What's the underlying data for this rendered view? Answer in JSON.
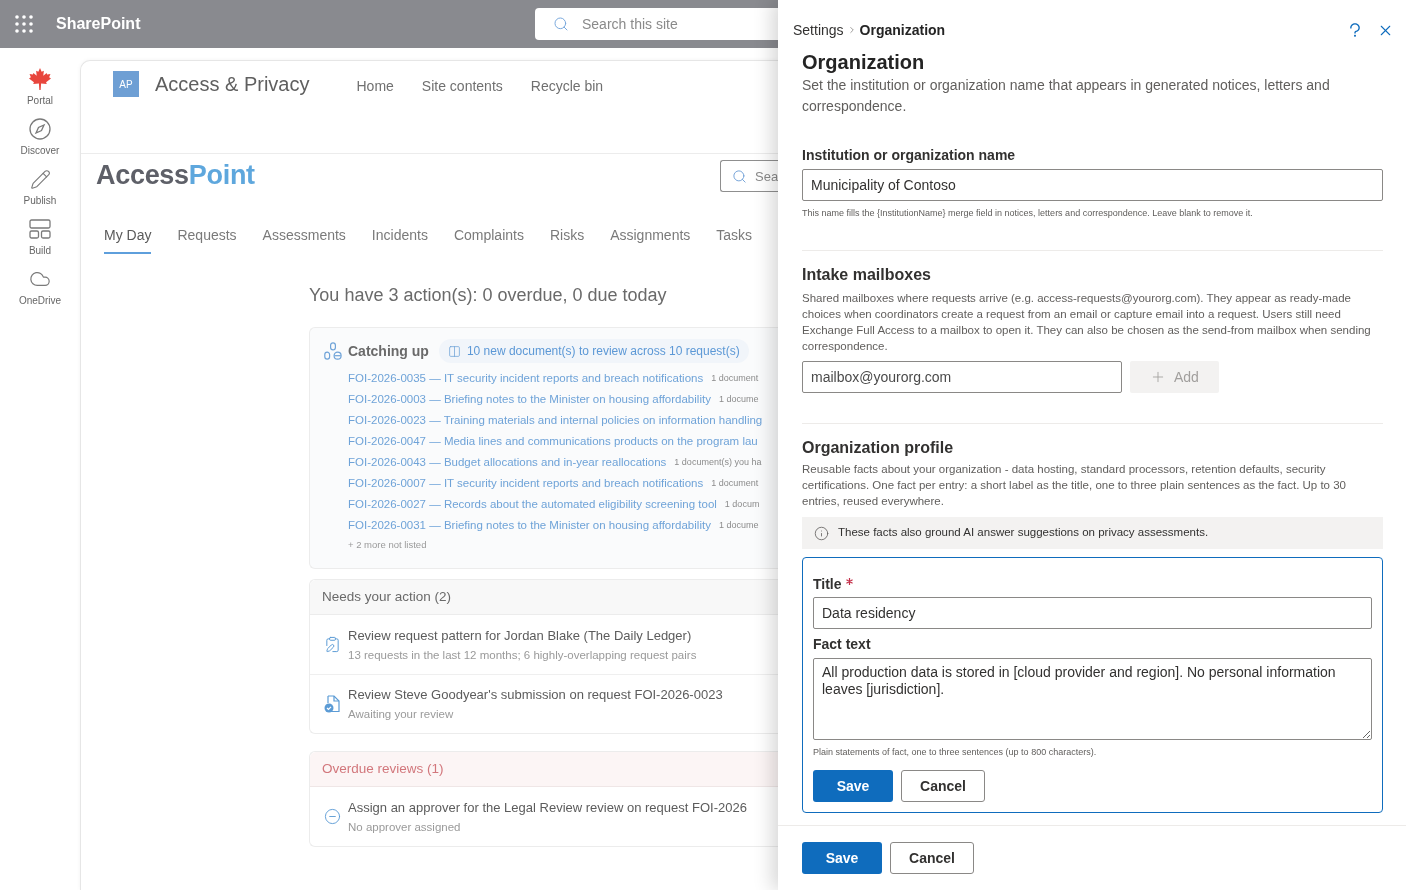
{
  "suite_bar": {
    "app_name": "SharePoint",
    "search": {
      "placeholder": "Search this site"
    }
  },
  "app_bar": {
    "items": [
      {
        "label": "Portal"
      },
      {
        "label": "Discover"
      },
      {
        "label": "Publish"
      },
      {
        "label": "Build"
      },
      {
        "label": "OneDrive"
      }
    ]
  },
  "site": {
    "logo_initials": "AP",
    "title": "Access & Privacy",
    "nav": [
      {
        "label": "Home"
      },
      {
        "label": "Site contents"
      },
      {
        "label": "Recycle bin"
      }
    ]
  },
  "app": {
    "logo": {
      "part_1": "Access",
      "part_2": "Point"
    },
    "search": {
      "placeholder": "Sea"
    },
    "tabs": [
      {
        "label": "My Day",
        "selected": true
      },
      {
        "label": "Requests",
        "selected": false
      },
      {
        "label": "Assessments",
        "selected": false
      },
      {
        "label": "Incidents",
        "selected": false
      },
      {
        "label": "Complaints",
        "selected": false
      },
      {
        "label": "Risks",
        "selected": false
      },
      {
        "label": "Assignments",
        "selected": false
      },
      {
        "label": "Tasks",
        "selected": false
      }
    ]
  },
  "summary": "You have 3 action(s): 0 overdue, 0 due today",
  "catching_up": {
    "title": "Catching up",
    "badge": "10 new document(s) to review across 10 request(s)",
    "items": [
      {
        "link": "FOI-2026-0035 — IT security incident reports and breach notifications",
        "note": "1 document"
      },
      {
        "link": "FOI-2026-0003 — Briefing notes to the Minister on housing affordability",
        "note": "1 docume"
      },
      {
        "link": "FOI-2026-0023 — Training materials and internal policies on information handling"
      },
      {
        "link": "FOI-2026-0047 — Media lines and communications products on the program lau"
      },
      {
        "link": "FOI-2026-0043 — Budget allocations and in-year reallocations",
        "note": "1 document(s) you ha"
      },
      {
        "link": "FOI-2026-0007 — IT security incident reports and breach notifications",
        "note": "1 document"
      },
      {
        "link": "FOI-2026-0027 — Records about the automated eligibility screening tool",
        "note": "1 docum"
      },
      {
        "link": "FOI-2026-0031 — Briefing notes to the Minister on housing affordability",
        "note": "1 docume"
      }
    ],
    "more": "+ 2 more not listed"
  },
  "action_groups": [
    {
      "kind": "normal",
      "title": "Needs your action (2)",
      "items": [
        {
          "kind": "pattern",
          "title": "Review request pattern for Jordan Blake (The Daily Ledger)",
          "subtitle": "13 requests in the last 12 months; 6 highly-overlapping request pairs"
        },
        {
          "kind": "submission",
          "title": "Review Steve Goodyear's submission on request FOI-2026-0023",
          "subtitle": "Awaiting your review"
        }
      ]
    },
    {
      "kind": "overdue",
      "title": "Overdue reviews (1)",
      "items": [
        {
          "kind": "approver",
          "title": "Assign an approver for the Legal Review review on request FOI-2026",
          "subtitle": "No approver assigned"
        }
      ]
    }
  ],
  "panel": {
    "breadcrumb": [
      {
        "label": "Settings",
        "current": false
      },
      {
        "label": "Organization",
        "current": true
      }
    ],
    "title": "Organization",
    "description": "Set the institution or organization name that appears in generated notices, letters and correspondence.",
    "institution": {
      "label": "Institution or organization name",
      "value": "Municipality of Contoso",
      "hint": "This name fills the {InstitutionName} merge field in notices, letters and correspondence. Leave blank to remove it."
    },
    "mailboxes": {
      "heading": "Intake mailboxes",
      "description": "Shared mailboxes where requests arrive (e.g. access-requests@yourorg.com). They appear as ready-made choices when coordinators create a request from an email or capture email into a request. Users still need Exchange Full Access to a mailbox to open it. They can also be chosen as the send-from mailbox when sending correspondence.",
      "input": {
        "placeholder": "mailbox@yourorg.com"
      },
      "add_button": {
        "label": "Add",
        "disabled": true
      }
    },
    "profile": {
      "heading": "Organization profile",
      "description": "Reusable facts about your organization - data hosting, standard processors, retention defaults, security certifications. One fact per entry: a short label as the title, one to three plain sentences as the fact. Up to 30 entries, reused everywhere.",
      "info": "These facts also ground AI answer suggestions on privacy assessments.",
      "editor": {
        "title_field": {
          "label": "Title",
          "required": true,
          "value": "Data residency"
        },
        "fact_field": {
          "label": "Fact text",
          "value": "All production data is stored in [cloud provider and region]. No personal information leaves [jurisdiction].",
          "hint": "Plain statements of fact, one to three sentences (up to 800 characters)."
        },
        "buttons": [
          {
            "label": "Save",
            "kind": "primary"
          },
          {
            "label": "Cancel",
            "kind": "secondary"
          }
        ]
      }
    },
    "footer_buttons": [
      {
        "label": "Save",
        "kind": "primary"
      },
      {
        "label": "Cancel",
        "kind": "secondary"
      }
    ]
  }
}
